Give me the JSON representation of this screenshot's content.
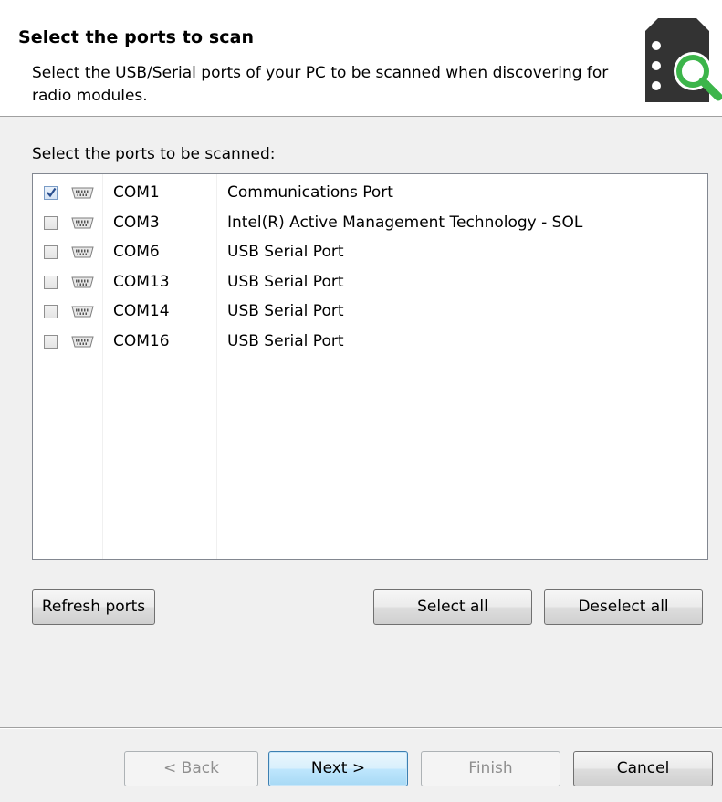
{
  "header": {
    "title": "Select the ports to scan",
    "description": "Select the USB/Serial ports of your PC to be scanned when discovering for radio modules.",
    "icon": "radio-module-search-icon"
  },
  "ports": {
    "label": "Select the ports to be scanned:",
    "rows": [
      {
        "checked": true,
        "icon": "serial-port-icon",
        "name": "COM1",
        "description": "Communications Port"
      },
      {
        "checked": false,
        "icon": "serial-port-icon",
        "name": "COM3",
        "description": "Intel(R) Active Management Technology - SOL"
      },
      {
        "checked": false,
        "icon": "serial-port-icon",
        "name": "COM6",
        "description": "USB Serial Port"
      },
      {
        "checked": false,
        "icon": "serial-port-icon",
        "name": "COM13",
        "description": "USB Serial Port"
      },
      {
        "checked": false,
        "icon": "serial-port-icon",
        "name": "COM14",
        "description": "USB Serial Port"
      },
      {
        "checked": false,
        "icon": "serial-port-icon",
        "name": "COM16",
        "description": "USB Serial Port"
      }
    ]
  },
  "actions": {
    "refresh": "Refresh ports",
    "select_all": "Select all",
    "deselect_all": "Deselect all"
  },
  "footer": {
    "back": "< Back",
    "next": "Next >",
    "finish": "Finish",
    "cancel": "Cancel"
  },
  "colors": {
    "icon_dark": "#333333",
    "icon_accent": "#3cb54a",
    "checkmark": "#2a4f8f"
  }
}
